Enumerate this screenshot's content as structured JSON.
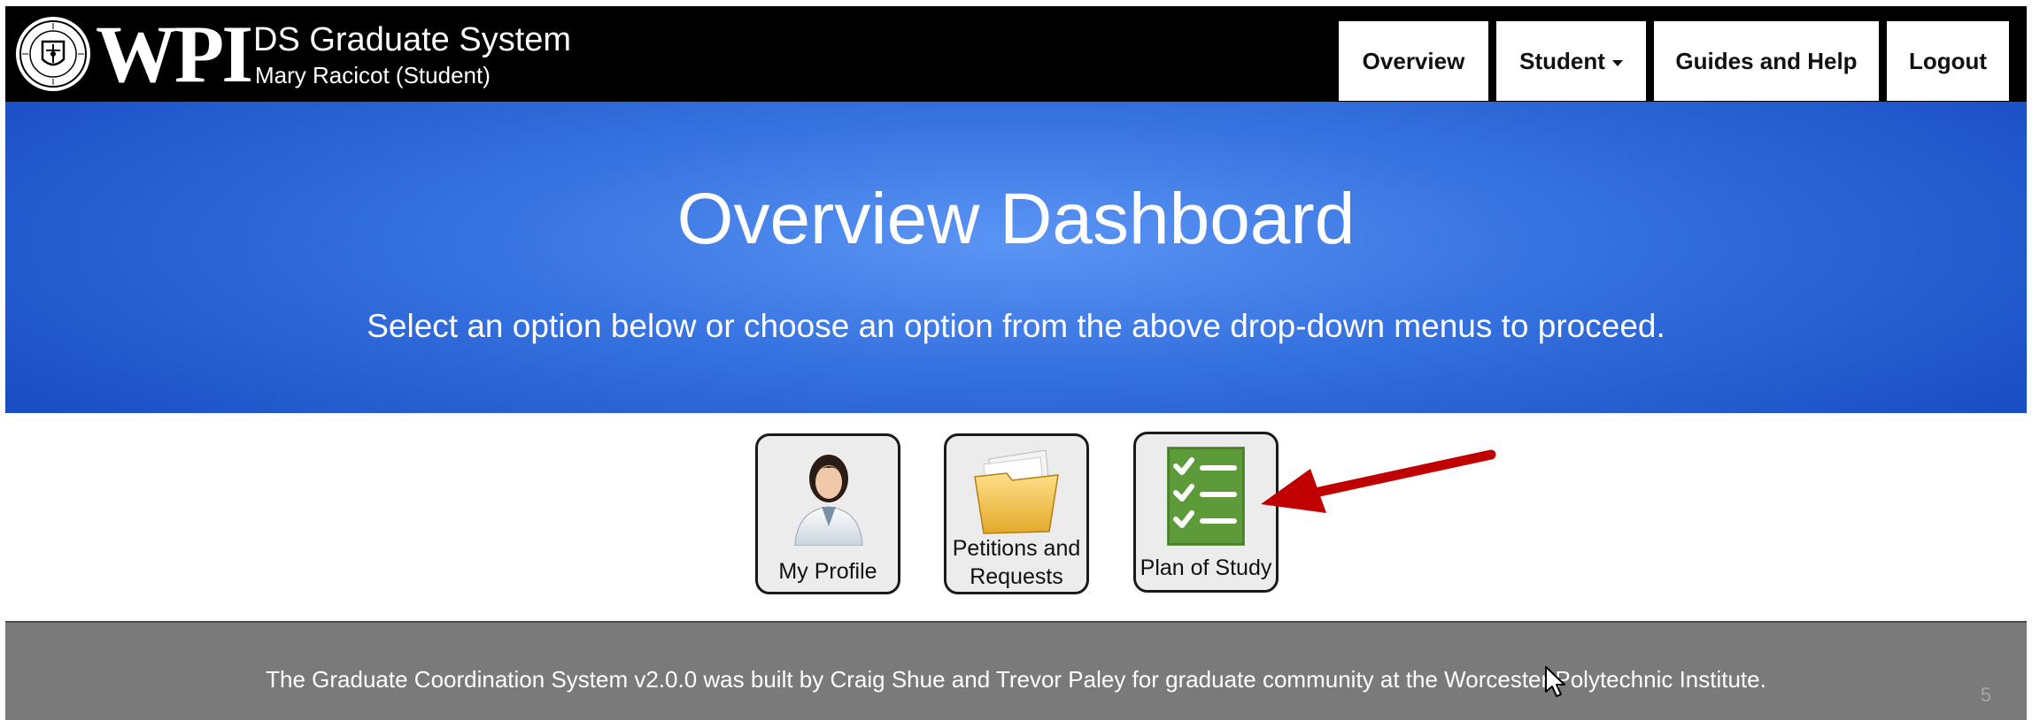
{
  "header": {
    "logo_text": "WPI",
    "app_title": "DS Graduate System",
    "user_label": "Mary Racicot (Student)"
  },
  "nav": {
    "overview": "Overview",
    "student": "Student",
    "guides": "Guides and Help",
    "logout": "Logout"
  },
  "hero": {
    "title": "Overview Dashboard",
    "subtitle": "Select an option below or choose an option from the above drop-down menus to proceed."
  },
  "tiles": [
    {
      "label": "My Profile",
      "icon": "person-icon"
    },
    {
      "label_line1": "Petitions and",
      "label_line2": "Requests",
      "icon": "folder-icon"
    },
    {
      "label": "Plan of Study",
      "icon": "checklist-icon"
    }
  ],
  "footer": {
    "text": "The Graduate Coordination System v2.0.0 was built by Craig Shue and Trevor Paley for graduate community at the Worcester Polytechnic Institute.",
    "slide_number": "5"
  },
  "colors": {
    "nav_bg": "#000000",
    "hero_blue": "#3672e0",
    "footer_gray": "#7a7a7a",
    "plan_green": "#5d9a3a",
    "arrow_red": "#c00000"
  }
}
